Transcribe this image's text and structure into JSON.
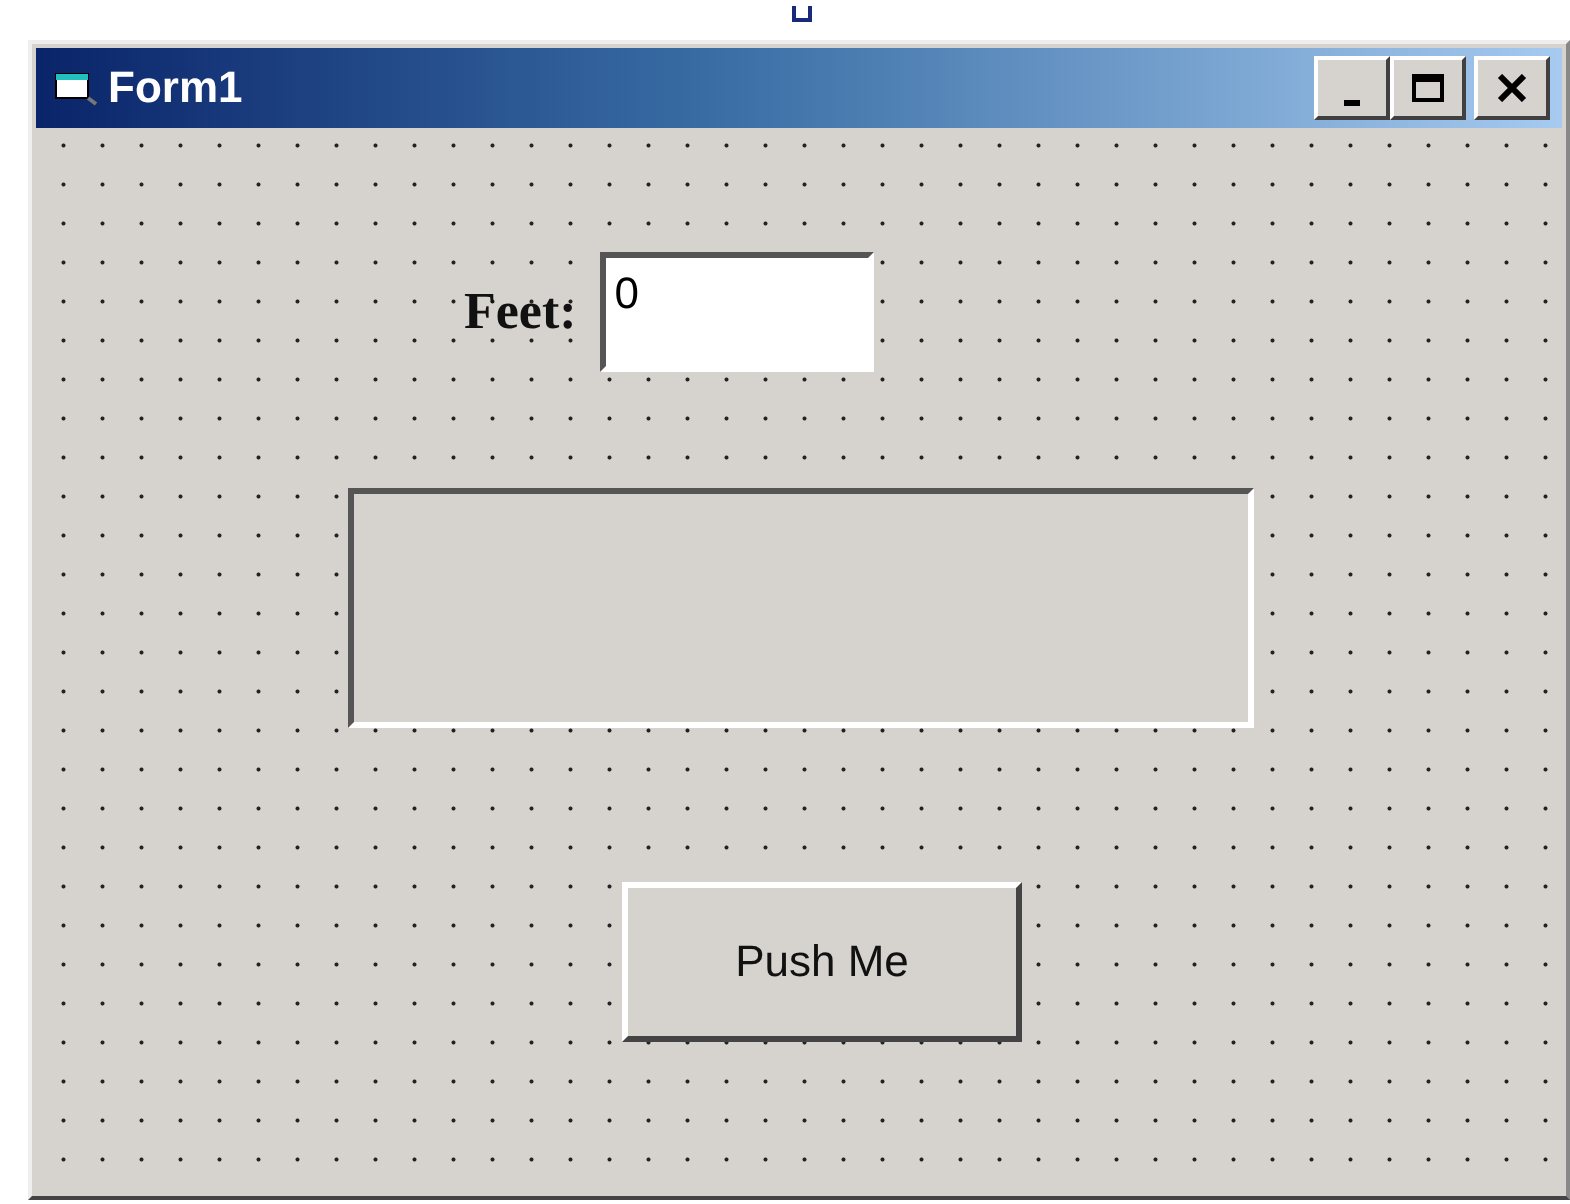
{
  "window": {
    "title": "Form1"
  },
  "form": {
    "feet_label": "Feet:",
    "feet_field": {
      "value": "0"
    },
    "button": "Push Me"
  }
}
